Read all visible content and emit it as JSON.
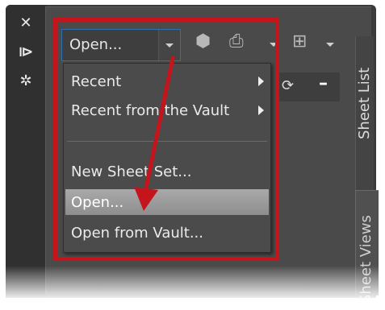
{
  "toolbar": {
    "open_combo_value": "Open..."
  },
  "menu": {
    "items": [
      {
        "label": "Recent",
        "submenu": true
      },
      {
        "label": "Recent from the Vault",
        "submenu": true
      },
      {
        "label": "New Sheet Set..."
      },
      {
        "label": "Open...",
        "active": true
      },
      {
        "label": "Open from Vault..."
      }
    ]
  },
  "side_tabs": {
    "sheet_list": "Sheet List",
    "sheet_views": "Sheet Views"
  },
  "colors": {
    "highlight_frame": "#c4141c",
    "arrow": "#c4141c",
    "combo_border": "#2f6fb0",
    "background": "#3b3b3b"
  },
  "icons": [
    "close-icon",
    "pin-icon",
    "settings-icon",
    "publish-icon",
    "plot-icon",
    "sheet-manager-icon",
    "refresh-icon",
    "minus-icon"
  ]
}
